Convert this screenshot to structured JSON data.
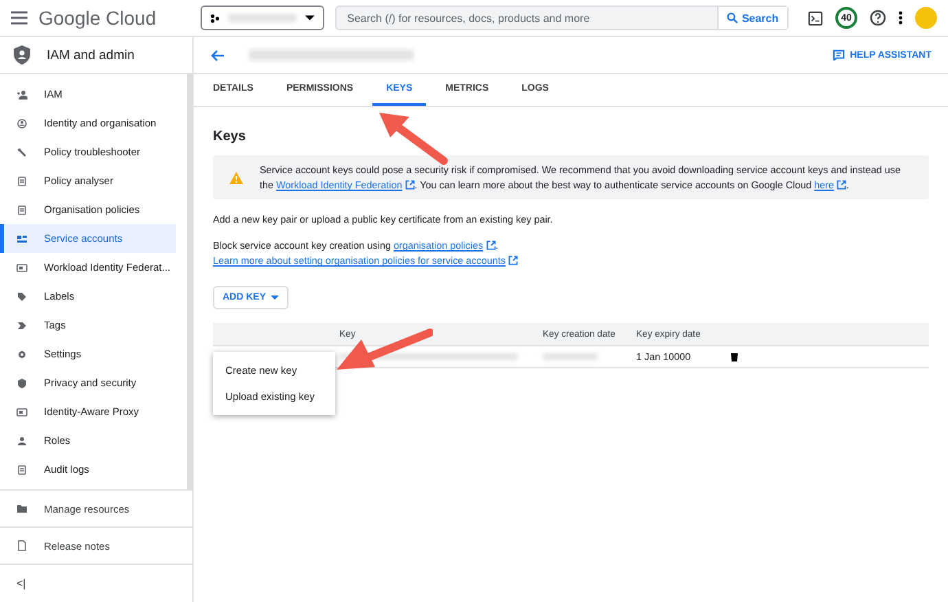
{
  "topbar": {
    "logo": "Google Cloud",
    "search": {
      "placeholder": "Search (/) for resources, docs, products and more"
    },
    "search_button": "Search",
    "badge": "40"
  },
  "product": {
    "title": "IAM and admin"
  },
  "sidebar": {
    "items": [
      {
        "label": "IAM",
        "selected": false
      },
      {
        "label": "Identity and organisation",
        "selected": false
      },
      {
        "label": "Policy troubleshooter",
        "selected": false
      },
      {
        "label": "Policy analyser",
        "selected": false
      },
      {
        "label": "Organisation policies",
        "selected": false
      },
      {
        "label": "Service accounts",
        "selected": true
      },
      {
        "label": "Workload Identity Federat...",
        "selected": false
      },
      {
        "label": "Labels",
        "selected": false
      },
      {
        "label": "Tags",
        "selected": false
      },
      {
        "label": "Settings",
        "selected": false
      },
      {
        "label": "Privacy and security",
        "selected": false
      },
      {
        "label": "Identity-Aware Proxy",
        "selected": false
      },
      {
        "label": "Roles",
        "selected": false
      },
      {
        "label": "Audit logs",
        "selected": false
      }
    ],
    "footer": [
      {
        "label": "Manage resources"
      },
      {
        "label": "Release notes"
      }
    ],
    "collapse": "<|"
  },
  "header": {
    "help": "HELP ASSISTANT"
  },
  "tabs": [
    {
      "label": "DETAILS",
      "selected": false
    },
    {
      "label": "PERMISSIONS",
      "selected": false
    },
    {
      "label": "KEYS",
      "selected": true
    },
    {
      "label": "METRICS",
      "selected": false
    },
    {
      "label": "LOGS",
      "selected": false
    }
  ],
  "content": {
    "title": "Keys",
    "warning": {
      "before": "Service account keys could pose a security risk if compromised. We recommend that you avoid downloading service account keys and instead use the ",
      "link1": "Workload Identity Federation",
      "middle": ". You can learn more about the best way to authenticate service accounts on Google Cloud ",
      "link2": "here",
      "after": "."
    },
    "intro": "Add a new key pair or upload a public key certificate from an existing key pair.",
    "block": {
      "before": "Block service account key creation using ",
      "link": "organisation policies",
      "after": "."
    },
    "learn_more": "Learn more about setting organisation policies for service accounts",
    "add_key": "ADD KEY",
    "menu": [
      {
        "label": "Create new key"
      },
      {
        "label": "Upload existing key"
      }
    ],
    "table": {
      "columns": [
        "Key",
        "Key creation date",
        "Key expiry date"
      ],
      "rows": [
        {
          "expiry": "1 Jan 10000"
        }
      ]
    }
  }
}
